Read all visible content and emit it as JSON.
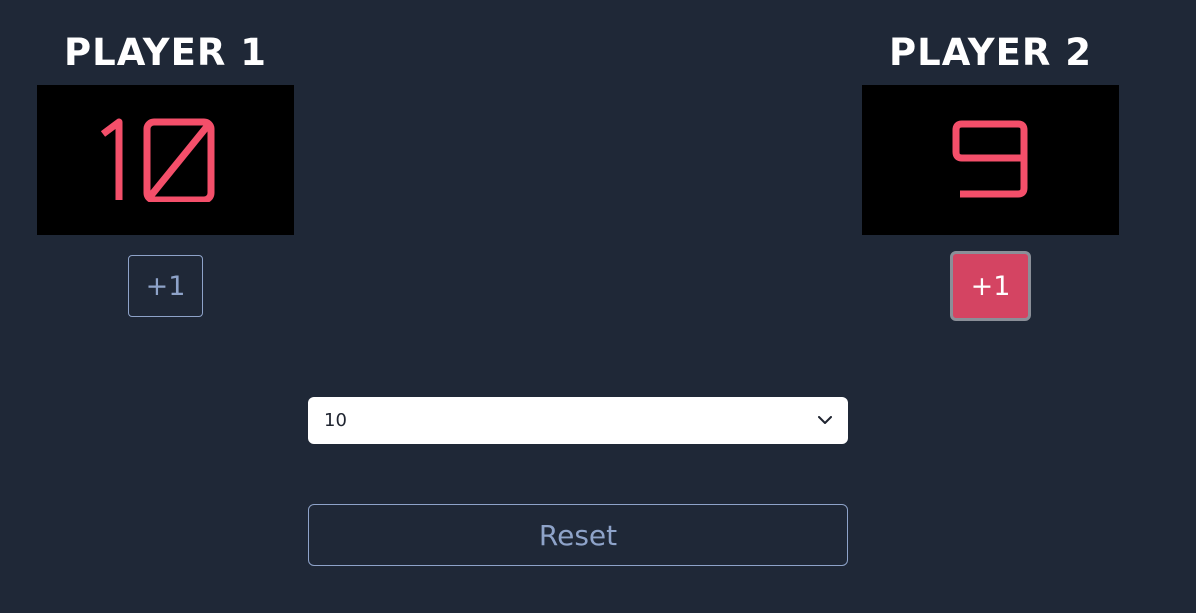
{
  "colors": {
    "background": "#1f2837",
    "digit": "#f44f6a",
    "accent_button": "#d44462",
    "outline": "#8ea3c9"
  },
  "players": [
    {
      "title": "PLAYER 1",
      "score": "10",
      "button_label": "+1"
    },
    {
      "title": "PLAYER 2",
      "score": "9",
      "button_label": "+1"
    }
  ],
  "goal_select": {
    "value": "10",
    "icon": "chevron-down-icon"
  },
  "reset": {
    "label": "Reset"
  }
}
